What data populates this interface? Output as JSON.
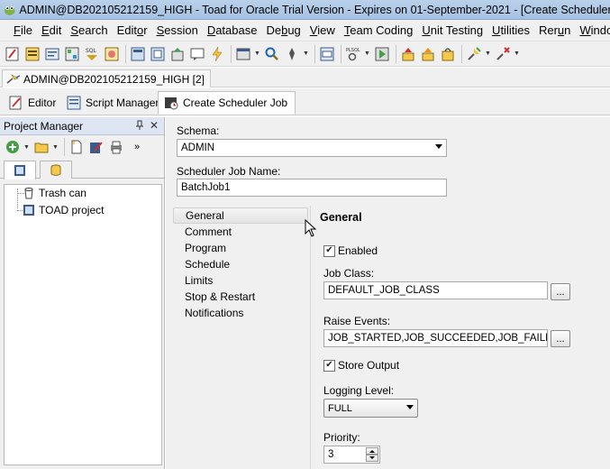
{
  "window": {
    "title": "ADMIN@DB202105212159_HIGH - Toad for Oracle Trial Version - Expires on 01-September-2021 - [Create Scheduler Job]"
  },
  "menu": {
    "items": [
      {
        "label": "File",
        "accel": "F",
        "rest": "ile"
      },
      {
        "label": "Edit",
        "accel": "E",
        "rest": "dit"
      },
      {
        "label": "Search",
        "accel": "S",
        "rest": "earch"
      },
      {
        "label": "Editor",
        "pre": "Edit",
        "accel": "o",
        "rest": "r"
      },
      {
        "label": "Session",
        "accel": "S",
        "rest": "ession"
      },
      {
        "label": "Database",
        "accel": "D",
        "rest": "atabase"
      },
      {
        "label": "Debug",
        "pre": "De",
        "accel": "b",
        "rest": "ug"
      },
      {
        "label": "View",
        "accel": "V",
        "rest": "iew"
      },
      {
        "label": "Team Coding",
        "accel": "T",
        "rest": "eam Coding"
      },
      {
        "label": "Unit Testing",
        "accel": "U",
        "rest": "nit Testing"
      },
      {
        "label": "Utilities",
        "accel": "U",
        "rest": "tilities"
      },
      {
        "label": "Rerun",
        "pre": "Rer",
        "accel": "u",
        "rest": "n"
      },
      {
        "label": "Window",
        "accel": "W",
        "rest": "indow"
      }
    ]
  },
  "connection": {
    "tab_label": "ADMIN@DB202105212159_HIGH [2]"
  },
  "editor_tabs": [
    {
      "label": "Editor"
    },
    {
      "label": "Script Manager"
    },
    {
      "label": "Create Scheduler Job"
    }
  ],
  "project_manager": {
    "title": "Project Manager",
    "pin": "Q",
    "close": "✕",
    "tree": [
      {
        "label": "Trash can"
      },
      {
        "label": "TOAD project"
      }
    ]
  },
  "form": {
    "schema_label": "Schema:",
    "schema_value": "ADMIN",
    "job_name_label": "Scheduler Job Name:",
    "job_name_value": "BatchJob1",
    "nav": [
      {
        "label": "General"
      },
      {
        "label": "Comment"
      },
      {
        "label": "Program"
      },
      {
        "label": "Schedule"
      },
      {
        "label": "Limits"
      },
      {
        "label": "Stop & Restart"
      },
      {
        "label": "Notifications"
      }
    ],
    "section_title": "General",
    "enabled_label": "Enabled",
    "enabled_checked": true,
    "job_class_label": "Job Class:",
    "job_class_value": "DEFAULT_JOB_CLASS",
    "ellipsis": "...",
    "raise_events_label": "Raise Events:",
    "raise_events_value": "JOB_STARTED,JOB_SUCCEEDED,JOB_FAILED,JOB",
    "store_output_label": "Store Output",
    "store_output_checked": true,
    "logging_level_label": "Logging Level:",
    "logging_level_value": "FULL",
    "priority_label": "Priority:",
    "priority_value": "3"
  }
}
